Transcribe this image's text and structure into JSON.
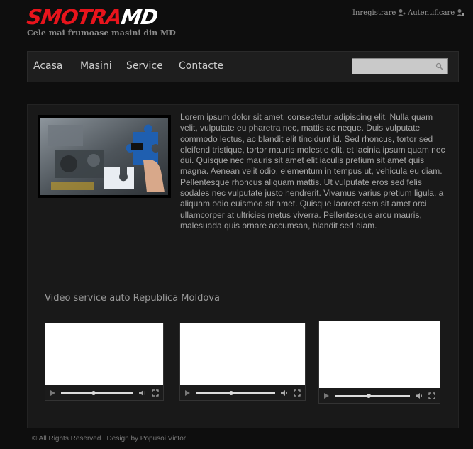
{
  "header": {
    "logo_red": "SMOTRA",
    "logo_white": "MD",
    "tagline": "Cele mai frumoase masini din MD",
    "register_label": "Inregistrare",
    "login_label": "Autentificare"
  },
  "nav": {
    "items": [
      {
        "label": "Acasa"
      },
      {
        "label": "Masini"
      },
      {
        "label": "Service"
      },
      {
        "label": "Contacte"
      }
    ],
    "search_value": ""
  },
  "main": {
    "image_icon": "engine-with-puzzle-piece-image",
    "text": "Lorem ipsum dolor sit amet, consectetur adipiscing elit. Nulla quam velit, vulputate eu pharetra nec, mattis ac neque. Duis vulputate commodo lectus, ac blandit elit tincidunt id. Sed rhoncus, tortor sed eleifend tristique, tortor mauris molestie elit, et lacinia ipsum quam nec dui. Quisque nec mauris sit amet elit iaculis pretium sit amet quis magna. Aenean velit odio, elementum in tempus ut, vehicula eu diam. Pellentesque rhoncus aliquam mattis. Ut vulputate eros sed felis sodales nec vulputate justo hendrerit. Vivamus varius pretium ligula, a aliquam odio euismod sit amet. Quisque laoreet sem sit amet orci ullamcorper at ultricies metus viverra. Pellentesque arcu mauris, malesuada quis ornare accumsan, blandit sed diam.",
    "video_title": "Video service auto Republica Moldova",
    "videos": [
      {
        "progress": 0.45
      },
      {
        "progress": 0.45
      },
      {
        "progress": 0.45
      }
    ]
  },
  "footer": {
    "text": "© All Rights Reserved | Design by Popusoi Victor"
  },
  "colors": {
    "accent_red": "#e8141c",
    "background": "#0e0e0e",
    "panel": "#191919",
    "navbar": "#1e1e1e"
  }
}
